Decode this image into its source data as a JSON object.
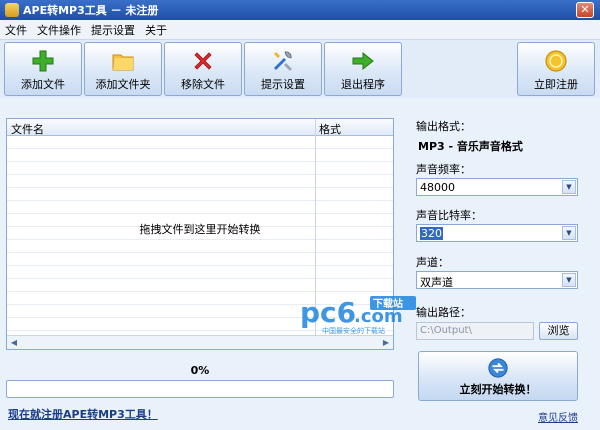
{
  "window": {
    "title": "APE转MP3工具 － 未注册",
    "close_glyph": "✕"
  },
  "menu": [
    "文件",
    "文件操作",
    "提示设置",
    "关于"
  ],
  "toolbar": {
    "add_file": "添加文件",
    "add_folder": "添加文件夹",
    "remove_file": "移除文件",
    "prompt_settings": "提示设置",
    "exit": "退出程序",
    "register": "立即注册"
  },
  "file_list": {
    "columns": [
      "文件名",
      "格式"
    ],
    "drop_hint": "拖拽文件到这里开始转换",
    "scroll_left": "◀",
    "scroll_right": "▶"
  },
  "progress": {
    "percent_label": "0%",
    "value": 0
  },
  "links": {
    "register": "现在就注册APE转MP3工具！",
    "feedback": "意见反馈"
  },
  "settings": {
    "output_format_label": "输出格式：",
    "output_format_value": "MP3 - 音乐声音格式",
    "sample_rate_label": "声音频率：",
    "sample_rate_value": "48000",
    "bitrate_label": "声音比特率：",
    "bitrate_value": "320",
    "channel_label": "声道：",
    "channel_value": "双声道",
    "output_path_label": "输出路径：",
    "output_path_value": "C:\\Output\\",
    "browse_label": "浏览",
    "dropdown_glyph": "▼"
  },
  "convert": {
    "label": "立刻开始转换！"
  },
  "watermark": {
    "brand": "pc6",
    "domain": ".com",
    "badge": "下载站",
    "tagline": "中国最安全的下载站"
  },
  "colors": {
    "accent": "#1f4fa8",
    "link": "#1a3e88"
  }
}
